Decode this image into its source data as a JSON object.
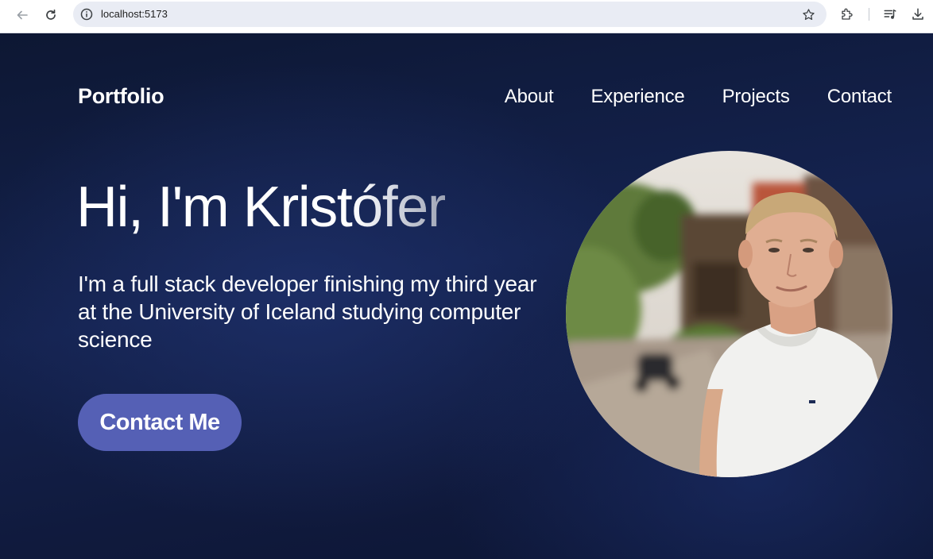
{
  "browser": {
    "url": "localhost:5173",
    "icons": [
      "back-arrow-icon",
      "reload-icon",
      "site-info-icon",
      "bookmark-star-icon",
      "extensions-icon",
      "media-controls-icon",
      "download-icon"
    ]
  },
  "header": {
    "brand": "Portfolio",
    "nav": [
      "About",
      "Experience",
      "Projects",
      "Contact"
    ]
  },
  "hero": {
    "title_plain": "Hi, I'm Krist",
    "title_faded": "ófer",
    "subtitle": "I'm a full stack developer finishing my third year at the University of Iceland studying computer science",
    "cta_label": "Contact Me"
  },
  "colors": {
    "background": "#0d1733",
    "accent": "#5560b5",
    "text": "#ffffff"
  }
}
